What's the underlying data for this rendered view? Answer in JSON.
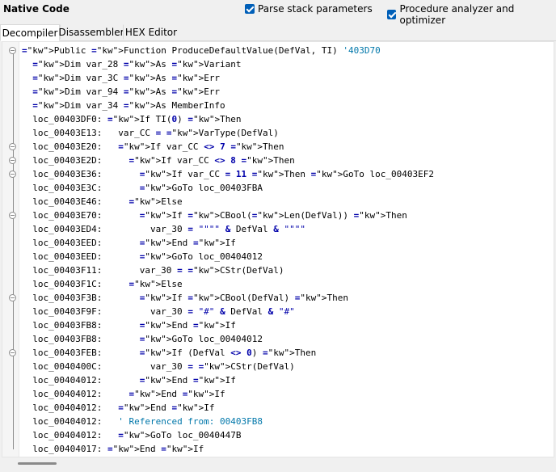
{
  "header": {
    "title": "Native Code",
    "options": [
      {
        "label": "Parse stack parameters",
        "checked": true
      },
      {
        "label": "Procedure analyzer and optimizer",
        "checked": true
      }
    ]
  },
  "tabs": [
    {
      "label": "Decompiler",
      "active": true
    },
    {
      "label": "Disassembler",
      "active": false
    },
    {
      "label": "HEX Editor",
      "active": false
    }
  ],
  "colors": {
    "keyword": "#0000aa",
    "accent": "#005fb8"
  },
  "code": [
    "Public Function ProduceDefaultValue(DefVal, TI) '403D70",
    "  Dim var_28 As Variant",
    "  Dim var_3C As Err",
    "  Dim var_94 As Err",
    "  Dim var_34 As MemberInfo",
    "  loc_00403DF0: If TI(0) Then",
    "  loc_00403E13:   var_CC = VarType(DefVal)",
    "  loc_00403E20:   If var_CC <> 7 Then",
    "  loc_00403E2D:     If var_CC <> 8 Then",
    "  loc_00403E36:       If var_CC = 11 Then GoTo loc_00403EF2",
    "  loc_00403E3C:       GoTo loc_00403FBA",
    "  loc_00403E46:     Else",
    "  loc_00403E70:       If CBool(Len(DefVal)) Then",
    "  loc_00403ED4:         var_30 = \"\"\"\" & DefVal & \"\"\"\"",
    "  loc_00403EED:       End If",
    "  loc_00403EED:       GoTo loc_00404012",
    "  loc_00403F11:       var_30 = CStr(DefVal)",
    "  loc_00403F1C:     Else",
    "  loc_00403F3B:       If CBool(DefVal) Then",
    "  loc_00403F9F:         var_30 = \"#\" & DefVal & \"#\"",
    "  loc_00403FB8:       End If",
    "  loc_00403FB8:       GoTo loc_00404012",
    "  loc_00403FEB:       If (DefVal <> 0) Then",
    "  loc_0040400C:         var_30 = CStr(DefVal)",
    "  loc_00404012:       End If",
    "  loc_00404012:     End If",
    "  loc_00404012:   End If",
    "  loc_00404012:   ' Referenced from: 00403FB8",
    "  loc_00404012:   GoTo loc_0040447B",
    "  loc_00404017: End If"
  ],
  "fold_markers_at_lines": [
    0,
    7,
    8,
    9,
    12,
    18,
    22
  ]
}
